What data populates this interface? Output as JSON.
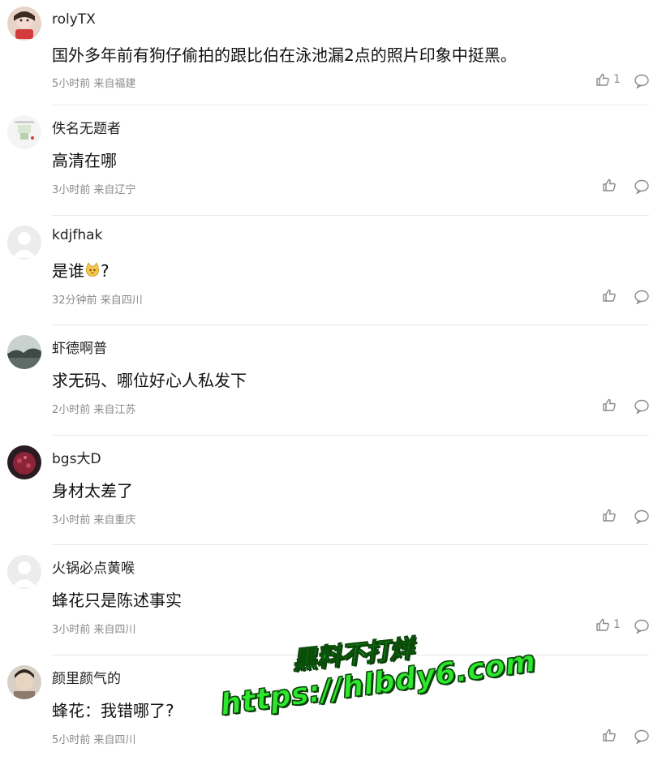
{
  "comments": [
    {
      "name": "rolyTX",
      "text": "国外多年前有狗仔偷拍的跟比伯在泳池漏2点的照片印象中挺黑。",
      "time": "5小时前",
      "location": "来自福建",
      "likes": "1",
      "avatar_color": "#c94c4c"
    },
    {
      "name": "佚名无题者",
      "text": "高清在哪",
      "time": "3小时前",
      "location": "来自辽宁",
      "likes": "",
      "avatar_color": "#f2f2f2"
    },
    {
      "name": "kdjfhak",
      "text": "是谁",
      "text_suffix": "?",
      "emoji": "cat-emoji",
      "time": "32分钟前",
      "location": "来自四川",
      "likes": "",
      "avatar_color": "#e6e6e6"
    },
    {
      "name": "虾德啊普",
      "text": "求无码、哪位好心人私发下",
      "time": "2小时前",
      "location": "来自江苏",
      "likes": "",
      "avatar_color": "#7c8a86"
    },
    {
      "name": "bgs大D",
      "text": "身材太差了",
      "time": "3小时前",
      "location": "来自重庆",
      "likes": "",
      "avatar_color": "#5a1f2e"
    },
    {
      "name": "火锅必点黄喉",
      "text": "蜂花只是陈述事实",
      "time": "3小时前",
      "location": "来自四川",
      "likes": "1",
      "avatar_color": "#e6e6e6"
    },
    {
      "name": "颜里颜气的",
      "text": "蜂花：我错哪了?",
      "time": "5小时前",
      "location": "来自四川",
      "likes": "",
      "avatar_color": "#b9a89a"
    }
  ],
  "watermark": {
    "line1": "黑料不打烊",
    "line2": "https://hlbdy6.com"
  },
  "colors": {
    "meta": "#8a8a8a",
    "divider": "#e8e8e8",
    "watermark": "#2ee82e"
  }
}
